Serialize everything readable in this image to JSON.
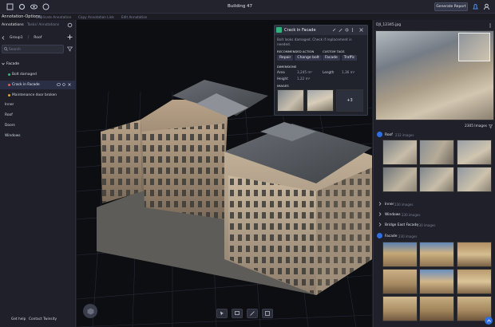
{
  "app": {
    "title": "Building 47",
    "generate_report_label": "Generate Report"
  },
  "subbar": {
    "options_label": "Annotation-Options:",
    "actions": [
      "Duplicate Annotation",
      "Copy Annotation Link",
      "Edit Annotation"
    ]
  },
  "left_panel": {
    "tabs": [
      "Annotations",
      "Tasks/ Annotations"
    ],
    "breadcrumb": [
      "Group1",
      "Roof"
    ],
    "search_placeholder": "Search",
    "items": [
      {
        "label": "Facade",
        "level": 0
      },
      {
        "label": "Bolt damaged",
        "level": 1
      },
      {
        "label": "Crack in Facade",
        "level": 1,
        "selected": true
      },
      {
        "label": "Maintenance door broken",
        "level": 1
      },
      {
        "label": "Inner",
        "level": 0
      },
      {
        "label": "Roof",
        "level": 0
      },
      {
        "label": "Doors",
        "level": 0
      },
      {
        "label": "Windows",
        "level": 0
      }
    ],
    "footer": [
      "Get help",
      "Contact Twinsity"
    ]
  },
  "popup": {
    "title": "Crack in Facade",
    "description": "Bolt looks damaged. Check if replacement is needed.",
    "recommended_action_label": "RECOMMENDED ACTION",
    "recommended_actions": [
      "Repair",
      "Change bolt"
    ],
    "custom_tags_label": "CUSTOM TAGS",
    "custom_tags": [
      "Facade",
      "Traffic"
    ],
    "dimensions_label": "DIMENSIONS",
    "area_label": "Area",
    "area_value": "3,245 m²",
    "length_label": "Length",
    "length_value": "1,36 m²",
    "height_label": "Height",
    "height_value": "1,22 m²",
    "images_label": "IMAGES",
    "more_images": "+3"
  },
  "right_panel": {
    "image_name": "DJI_12345.jpg",
    "image_count": "2305 Images",
    "groups": [
      {
        "name": "Roof",
        "count": "232 images",
        "expanded": true
      },
      {
        "name": "Inner",
        "count": "230 images",
        "expanded": false
      },
      {
        "name": "Windows",
        "count": "230 images",
        "expanded": false
      },
      {
        "name": "Bridge East Facade",
        "count": "230 images",
        "expanded": false
      },
      {
        "name": "Facade",
        "count": "230 images",
        "expanded": true
      }
    ]
  },
  "colors": {
    "accent": "#2f6fe0",
    "selected_bg": "#2a2f45",
    "popup_title_bg": "#2d2f3c"
  }
}
